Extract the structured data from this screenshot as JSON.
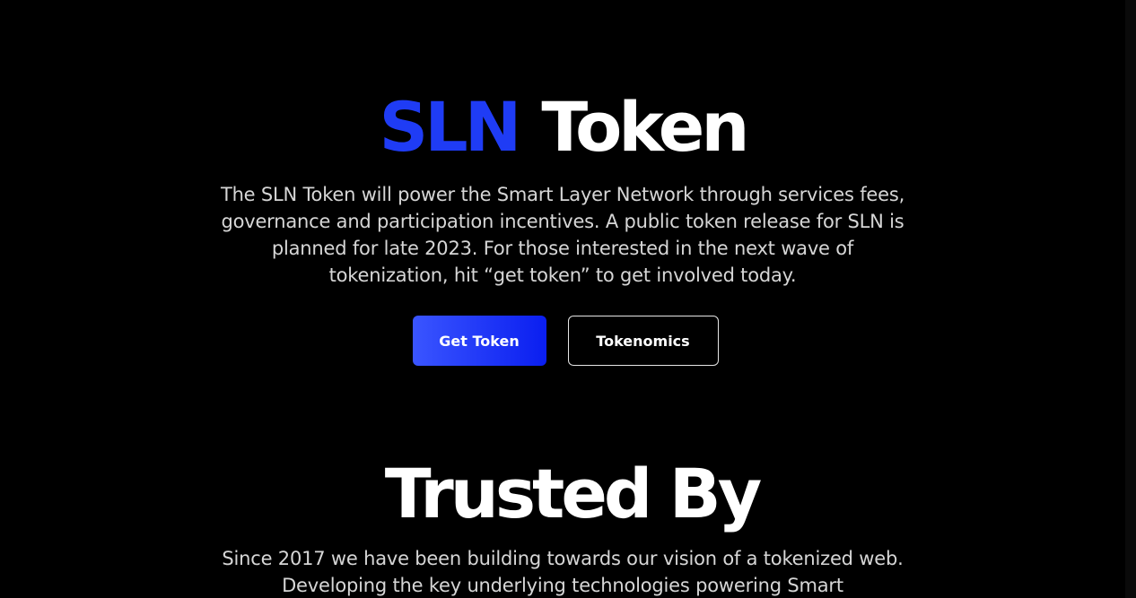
{
  "token": {
    "title_accent": "SLN",
    "title_rest": "Token",
    "description": "The SLN Token will power the Smart Layer Network through services fees, governance and participation incentives. A public token release for SLN is planned for late 2023. For those interested in the next wave of tokenization, hit “get token” to get involved today.",
    "buttons": {
      "get_token": "Get Token",
      "tokenomics": "Tokenomics"
    }
  },
  "trusted": {
    "title": "Trusted By",
    "description": "Since 2017 we have been building towards our vision of a tokenized web. Developing the key underlying technologies powering Smart"
  },
  "colors": {
    "background": "#000000",
    "accent": "#1f3cf5",
    "text": "#ffffff",
    "muted_text": "#d6d6d6"
  }
}
